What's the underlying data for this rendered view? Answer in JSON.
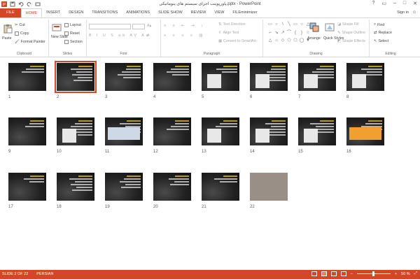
{
  "window": {
    "title": "پاورپوینت اجزای سیستم های پنوماتیکی.pptx - PowerPoint",
    "controls": [
      "?",
      "▭",
      "–",
      "□",
      "✕"
    ]
  },
  "tabs": [
    "FILE",
    "HOME",
    "INSERT",
    "DESIGN",
    "TRANSITIONS",
    "ANIMATIONS",
    "SLIDE SHOW",
    "REVIEW",
    "VIEW",
    "FILEminimizer"
  ],
  "active_tab": "HOME",
  "signin": "Sign in",
  "ribbon": {
    "clipboard": {
      "label": "Clipboard",
      "paste": "Paste",
      "cut": "Cut",
      "copy": "Copy",
      "format_painter": "Format Painter"
    },
    "slides": {
      "label": "Slides",
      "new_slide": "New Slide",
      "layout": "Layout",
      "reset": "Reset",
      "section": "Section"
    },
    "font": {
      "label": "Font"
    },
    "paragraph": {
      "label": "Paragraph",
      "text_direction": "Text Direction",
      "align_text": "Align Text",
      "convert": "Convert to SmartArt"
    },
    "drawing": {
      "label": "Drawing",
      "arrange": "Arrange",
      "quick_styles": "Quick Styles",
      "shape_fill": "Shape Fill",
      "shape_outline": "Shape Outline",
      "shape_effects": "Shape Effects"
    },
    "editing": {
      "label": "Editing",
      "find": "Find",
      "replace": "Replace",
      "select": "Select"
    }
  },
  "slides": [
    {
      "n": "1"
    },
    {
      "n": "2"
    },
    {
      "n": "3"
    },
    {
      "n": "4"
    },
    {
      "n": "5"
    },
    {
      "n": "6"
    },
    {
      "n": "7"
    },
    {
      "n": "8"
    },
    {
      "n": "9"
    },
    {
      "n": "10"
    },
    {
      "n": "11"
    },
    {
      "n": "12"
    },
    {
      "n": "13"
    },
    {
      "n": "14"
    },
    {
      "n": "15"
    },
    {
      "n": "16"
    },
    {
      "n": "17"
    },
    {
      "n": "18"
    },
    {
      "n": "19"
    },
    {
      "n": "20"
    },
    {
      "n": "21"
    },
    {
      "n": "22"
    }
  ],
  "selected_slide": "2",
  "status": {
    "slide": "SLIDE 2 OF 22",
    "language": "PERSIAN",
    "zoom": "50 %"
  },
  "colors": {
    "accent": "#d24726"
  }
}
